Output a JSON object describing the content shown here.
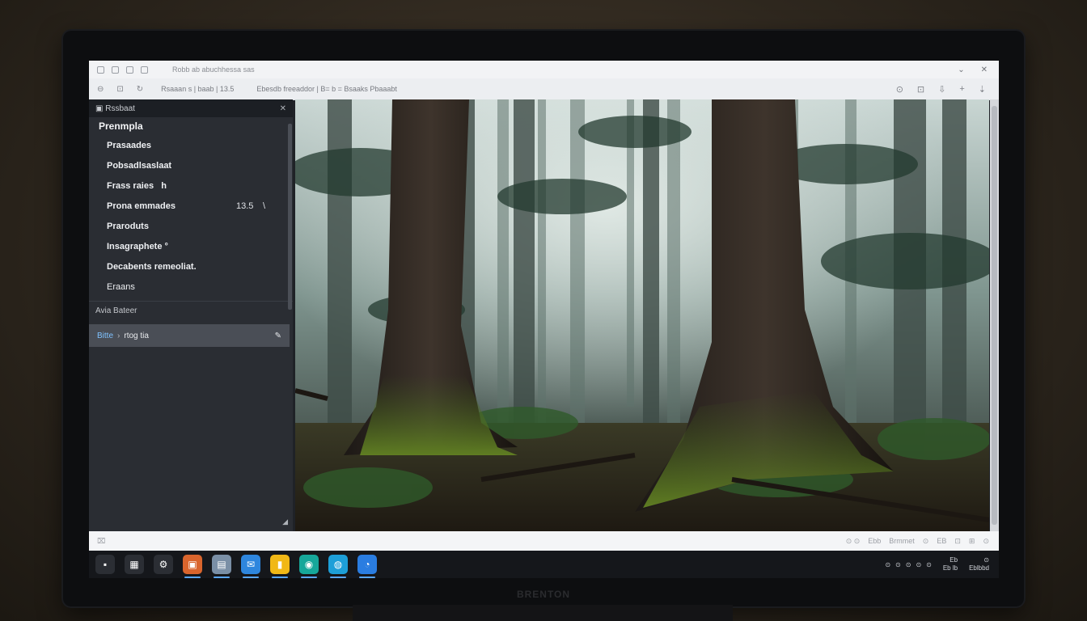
{
  "monitor": {
    "brand": "BRENTON"
  },
  "browser": {
    "title": "Robb ab abuchhessa sas",
    "window_controls": [
      "⌄",
      "✕"
    ],
    "address_url": "Rsaaan s | baab | 13.5",
    "page_title": "Ebesdb freeaddor | B= b = Bsaaks Pbaaabt",
    "toolbar_icons": [
      "⊙",
      "⊡",
      "⇩",
      "+",
      "⇣"
    ]
  },
  "sidebar": {
    "header": "Rssbaat",
    "close_label": "✕",
    "group_title": "Prenmpla",
    "items": [
      {
        "label": "Prasaades",
        "value": "",
        "mark": ""
      },
      {
        "label": "Pobsadlsaslaat",
        "value": "",
        "mark": ""
      },
      {
        "label": "Frass raies",
        "value": "h",
        "mark": ""
      },
      {
        "label": "Prona emmades",
        "value": "13.5",
        "mark": "\\"
      },
      {
        "label": "Praroduts",
        "value": "",
        "mark": ""
      },
      {
        "label": "Insagraphete °",
        "value": "",
        "mark": ""
      },
      {
        "label": "Decabents remeoliat.",
        "value": "",
        "mark": ""
      },
      {
        "label": "Eraans",
        "value": "",
        "mark": ""
      }
    ],
    "footer_label": "Avia  Bateer",
    "selected": {
      "part_a": "Bitte",
      "separator": "›",
      "part_b": "rtog tia",
      "edit_icon": "✎"
    }
  },
  "statusbar": {
    "left": "⌧",
    "right": [
      "⊙ ⊙",
      "Ebb",
      "Brmmet",
      "⊙",
      "EB",
      "⊡",
      "⊞",
      "⊙"
    ]
  },
  "taskbar": {
    "apps": [
      {
        "name": "start",
        "glyph": "▪",
        "color": "#2b2e34"
      },
      {
        "name": "files",
        "glyph": "▦",
        "color": "#2b2e34"
      },
      {
        "name": "chat",
        "glyph": "⚙",
        "color": "#2b2e34"
      },
      {
        "name": "app-orange",
        "glyph": "▣",
        "color": "#d9652d"
      },
      {
        "name": "app-gallery",
        "glyph": "▤",
        "color": "#7a8fa6"
      },
      {
        "name": "app-mail",
        "glyph": "✉",
        "color": "#2e86de"
      },
      {
        "name": "app-yellow",
        "glyph": "▮",
        "color": "#f1b816"
      },
      {
        "name": "app-teal",
        "glyph": "◉",
        "color": "#16a79a"
      },
      {
        "name": "app-cyan",
        "glyph": "◍",
        "color": "#1d9fd8"
      },
      {
        "name": "app-blue",
        "glyph": "◔",
        "color": "#2a7de1"
      }
    ],
    "tray": [
      "⊙",
      "⊙",
      "⊙",
      "⊙",
      "⊙"
    ],
    "clock_time": "Eb",
    "clock_date": "Eb  lb",
    "clock_extra": "⊙",
    "clock_extra_label": "Eblbbd"
  },
  "colors": {
    "sidebar_bg": "#2a2d33",
    "selected_bg": "#4a4e56",
    "accent": "#7fc2ff",
    "taskbar_bg": "#15171b"
  }
}
